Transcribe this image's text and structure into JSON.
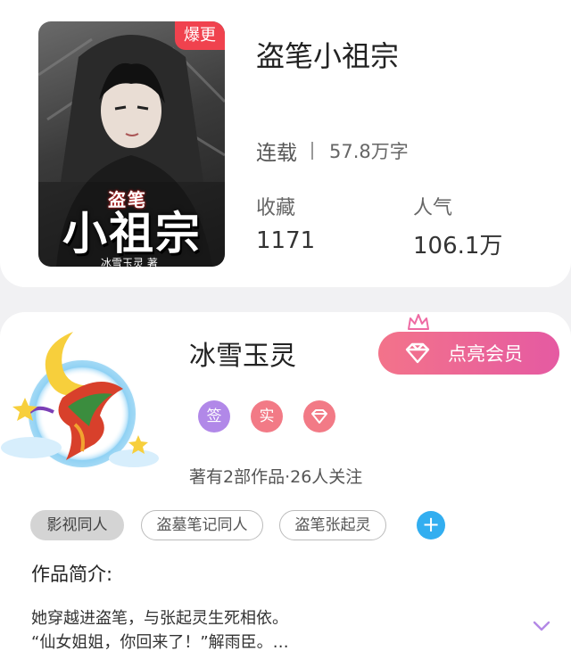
{
  "book": {
    "badge": "爆更",
    "title": "盗笔小祖宗",
    "cover_small_title": "盗笔",
    "cover_big_title": "小祖宗",
    "cover_author": "冰雪玉灵 著",
    "status": "连载",
    "word_count": "57.8万字",
    "stats": [
      {
        "label": "收藏",
        "value": "1171"
      },
      {
        "label": "人气",
        "value": "106.1万"
      }
    ]
  },
  "author": {
    "name": "冰雪玉灵",
    "member_button": "点亮会员",
    "badges": [
      {
        "label": "签",
        "color": "#b188e8"
      },
      {
        "label": "实",
        "color": "#f27a86"
      },
      {
        "icon": "diamond-icon",
        "color": "#f27a86"
      }
    ],
    "works_info": "著有2部作品·26人关注",
    "tags": [
      "影视同人",
      "盗墓笔记同人",
      "盗笔张起灵"
    ]
  },
  "intro": {
    "label": "作品简介:",
    "line1": "她穿越进盗笔，与张起灵生死相依。",
    "line2": "“仙女姐姐，你回来了！”解雨臣。…"
  },
  "colors": {
    "accent_pink": "#e55aa2",
    "badge_red": "#f0424e",
    "plus_blue": "#32aef0"
  }
}
